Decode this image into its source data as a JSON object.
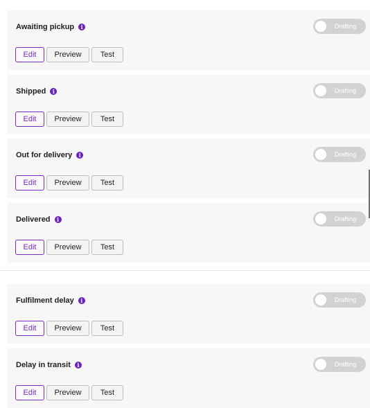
{
  "notifications": [
    {
      "title": "Awaiting pickup",
      "status": "Drafting",
      "edit": "Edit",
      "preview": "Preview",
      "test": "Test"
    },
    {
      "title": "Shipped",
      "status": "Drafting",
      "edit": "Edit",
      "preview": "Preview",
      "test": "Test"
    },
    {
      "title": "Out for delivery",
      "status": "Drafting",
      "edit": "Edit",
      "preview": "Preview",
      "test": "Test"
    },
    {
      "title": "Delivered",
      "status": "Drafting",
      "edit": "Edit",
      "preview": "Preview",
      "test": "Test"
    },
    {
      "title": "Fulfilment delay",
      "status": "Drafting",
      "edit": "Edit",
      "preview": "Preview",
      "test": "Test"
    },
    {
      "title": "Delay in transit",
      "status": "Drafting",
      "edit": "Edit",
      "preview": "Preview",
      "test": "Test"
    }
  ],
  "icons": {
    "info": "info-icon"
  },
  "colors": {
    "accent": "#7b2bc6",
    "info_icon": "#6b21c8",
    "toggle_off": "#d2d2d2",
    "card_bg": "#f7f7f7"
  }
}
